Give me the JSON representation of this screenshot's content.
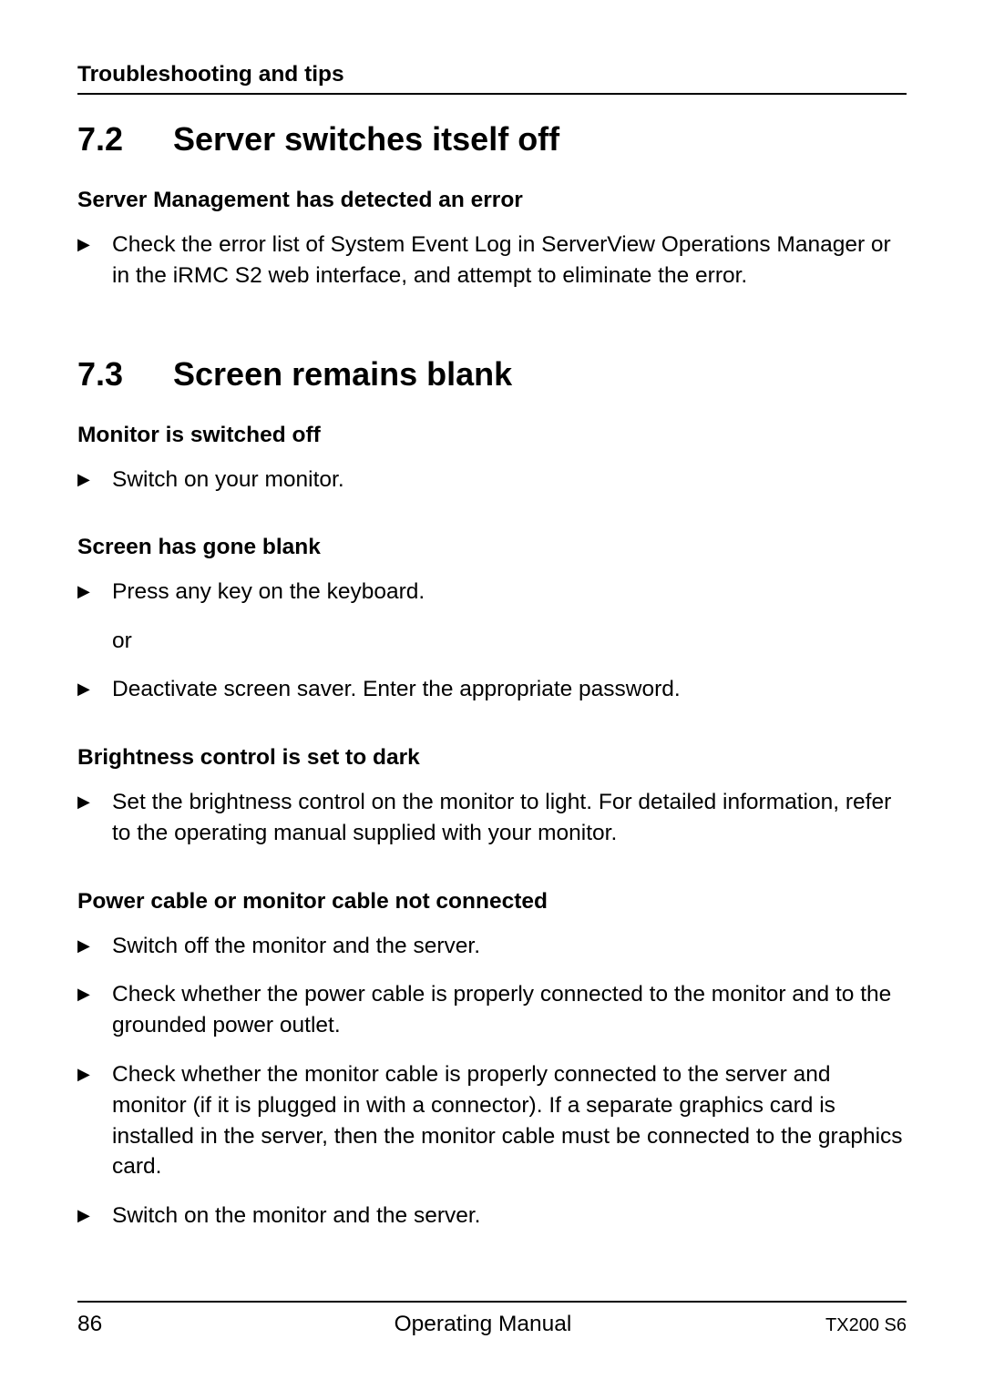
{
  "header": {
    "title": "Troubleshooting and tips"
  },
  "sections": [
    {
      "number": "7.2",
      "title": "Server switches itself off",
      "blocks": [
        {
          "heading": "Server Management has detected an error",
          "items": [
            {
              "type": "bullet",
              "text": "Check the error list of System Event Log in ServerView Operations Manager or in the iRMC S2 web interface, and attempt to eliminate the error."
            }
          ]
        }
      ]
    },
    {
      "number": "7.3",
      "title": "Screen remains blank",
      "blocks": [
        {
          "heading": "Monitor is switched off",
          "items": [
            {
              "type": "bullet",
              "text": "Switch on your monitor."
            }
          ]
        },
        {
          "heading": "Screen has gone blank",
          "items": [
            {
              "type": "bullet",
              "text": "Press any key on the keyboard."
            },
            {
              "type": "indent",
              "text": "or"
            },
            {
              "type": "bullet",
              "text": "Deactivate screen saver. Enter the appropriate password."
            }
          ]
        },
        {
          "heading": "Brightness control is set to dark",
          "items": [
            {
              "type": "bullet",
              "text": "Set the brightness control on the monitor to light. For detailed information, refer to the operating manual supplied with your monitor."
            }
          ]
        },
        {
          "heading": "Power cable or monitor cable not connected",
          "items": [
            {
              "type": "bullet",
              "text": "Switch off the monitor and the server."
            },
            {
              "type": "bullet",
              "text": "Check whether the power cable is properly connected to the monitor and to the grounded power outlet."
            },
            {
              "type": "bullet",
              "text": "Check whether the monitor cable is properly connected to the server and monitor (if it is plugged in with a connector). If a separate graphics card is installed in the server, then the monitor cable must be connected to the graphics card."
            },
            {
              "type": "bullet",
              "text": "Switch on the monitor and the server."
            }
          ]
        }
      ]
    }
  ],
  "footer": {
    "page_number": "86",
    "center": "Operating Manual",
    "right": "TX200 S6"
  },
  "bullet_glyph": "▶"
}
